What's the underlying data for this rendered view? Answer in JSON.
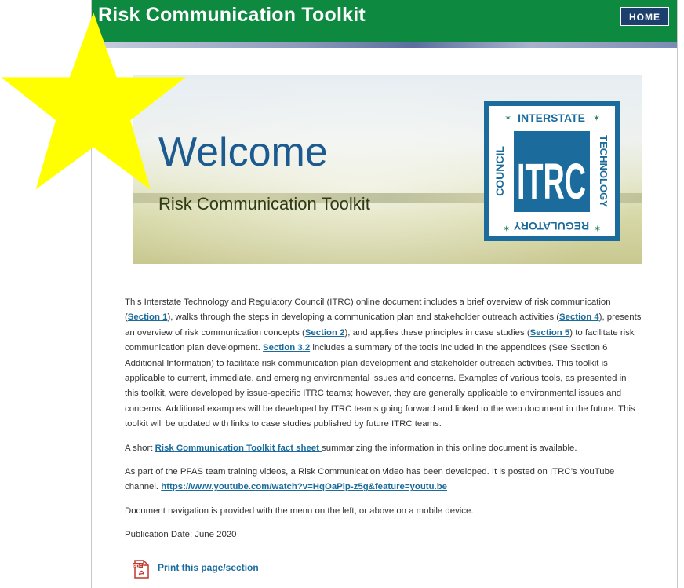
{
  "header": {
    "title": "Risk Communication Toolkit",
    "home_label": "HOME",
    "bg_color": "#0d8a3f"
  },
  "banner": {
    "welcome": "Welcome",
    "subtitle": "Risk Communication Toolkit",
    "logo": {
      "top_text": "INTERSTATE",
      "left_text": "COUNCIL",
      "right_text": "TECHNOLOGY",
      "bottom_text": "REGULATORY",
      "mark": "ITRC",
      "color": "#1b6c9c"
    }
  },
  "content": {
    "p1": {
      "t1": "This Interstate Technology and Regulatory Council (ITRC) online document includes a brief overview of risk communication (",
      "l1": "Section 1",
      "t2": "), walks through the steps in developing a communication plan and stakeholder outreach activities (",
      "l2": "Section 4",
      "t3": "), presents an overview of risk communication concepts (",
      "l3": "Section 2",
      "t4": "), and applies these principles in case studies (",
      "l4": "Section 5",
      "t5": ") to facilitate risk communication plan development. ",
      "l5": "Section 3.2",
      "t6": " includes a summary of the tools included in the appendices (See Section 6 Additional Information) to facilitate risk communication plan development and stakeholder outreach activities. This toolkit is applicable to current, immediate, and emerging environmental issues and concerns. Examples of various tools, as presented in this toolkit, were developed by issue-specific ITRC teams; however, they are generally applicable to environmental issues and concerns. Additional examples will be developed by ITRC teams going forward and linked to the web document in the future. This toolkit will be updated with links to case studies published by future ITRC teams."
    },
    "p2": {
      "t1": "A short ",
      "link": "Risk Communication Toolkit fact sheet ",
      "t2": "summarizing the information in this online document is available."
    },
    "p3": {
      "t1": "As part of the PFAS team training videos, a Risk Communication video has been developed. It is posted on ITRC’s YouTube channel. ",
      "link": "https://www.youtube.com/watch?v=HqOaPip-z5g&feature=youtu.be"
    },
    "p4": "Document navigation is provided with the menu on the left, or above on a mobile device.",
    "p5": "Publication Date: June 2020",
    "print_label": "Print this page/section",
    "print_icon_text": "PDF"
  },
  "overlay": {
    "star_color": "#ffff00",
    "icon": "star-icon"
  }
}
